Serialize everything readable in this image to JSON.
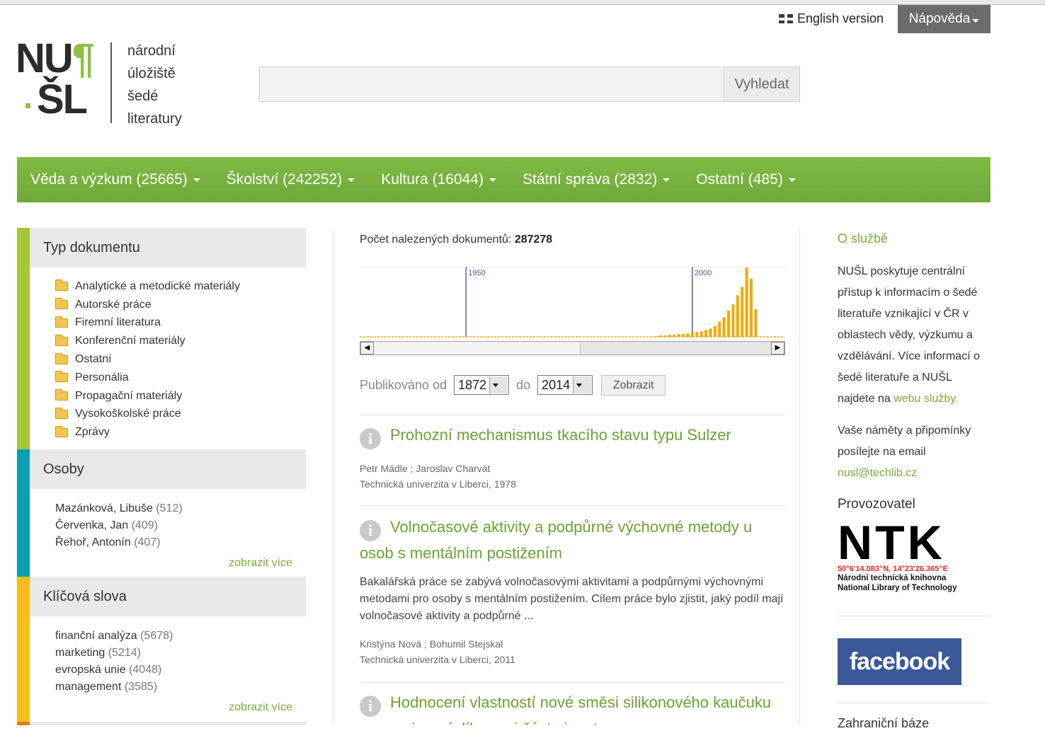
{
  "header": {
    "english_version": "English version",
    "help": "Nápověda",
    "logo_letters_top": "NU",
    "logo_para": "¶",
    "logo_letters_bottom": "ŠL",
    "logo_lines": [
      "národní",
      "úložiště",
      "šedé",
      "literatury"
    ],
    "search_placeholder": "",
    "search_value": "",
    "search_button": "Vyhledat"
  },
  "nav": [
    {
      "label": "Věda a výzkum (25665)"
    },
    {
      "label": "Školství (242252)"
    },
    {
      "label": "Kultura (16044)"
    },
    {
      "label": "Státní správa (2832)"
    },
    {
      "label": "Ostatní (485)"
    }
  ],
  "sidebar": {
    "doc_type": {
      "title": "Typ dokumentu",
      "color": "#a4c639",
      "items": [
        "Analytické a metodické materiály",
        "Autorské práce",
        "Firemní literatura",
        "Konferenční materiály",
        "Ostatní",
        "Personália",
        "Propagační materiály",
        "Vysokoškolské práce",
        "Zprávy"
      ]
    },
    "persons": {
      "title": "Osoby",
      "color": "#0aa0b4",
      "items": [
        {
          "name": "Mazánková, Libuše",
          "count": "(512)"
        },
        {
          "name": "Červenka, Jan",
          "count": "(409)"
        },
        {
          "name": "Řehoř, Antonín",
          "count": "(407)"
        }
      ],
      "more": "zobrazit více"
    },
    "keywords": {
      "title": "Klíčová slova",
      "color": "#f9bd1a",
      "items": [
        {
          "name": "finanční analýza",
          "count": "(5678)"
        },
        {
          "name": "marketing",
          "count": "(5214)"
        },
        {
          "name": "evropská unie",
          "count": "(4048)"
        },
        {
          "name": "management",
          "count": "(3585)"
        }
      ],
      "more": "zobrazit více"
    }
  },
  "main": {
    "count_label": "Počet nalezených dokumentů:",
    "count_value": "287278",
    "published_from_label": "Publikováno od",
    "from_value": "1872",
    "to_label": "do",
    "to_value": "2014",
    "show_button": "Zobrazit",
    "results": [
      {
        "title": "Prohozní mechanismus tkacího stavu typu Sulzer",
        "abstract": "",
        "authors": "Petr Mádle ; Jaroslav Charvát",
        "source": "Technická univerzita v Liberci, 1978"
      },
      {
        "title": "Volnočasové aktivity a podpůrné výchovné metody u osob s mentálním postižením",
        "abstract": "Bakalářská práce se zabývá volnočasovými aktivitami a podpůrnými výchovnými metodami pro osoby s mentálním postižením. Cílem práce bylo zjistit, jaký podíl mají volnočasové aktivity a podpůrné ...",
        "authors": "Kristýna Nová ; Bohumil Stejskal",
        "source": "Technická univerzita v Liberci, 2011"
      },
      {
        "title": "Hodnocení vlastností nové směsi silikonového kaučuku pro spojovací díly mezi čéstmi motoru",
        "abstract": "",
        "authors": "",
        "source": ""
      }
    ]
  },
  "chart_data": {
    "type": "bar",
    "title": "",
    "xlabel": "",
    "ylabel": "",
    "marker_labels": [
      "1950",
      "2000"
    ],
    "bar_color": "#f7a600",
    "x": [
      1992,
      1993,
      1994,
      1995,
      1996,
      1997,
      1998,
      1999,
      2000,
      2001,
      2002,
      2003,
      2004,
      2005,
      2006,
      2007,
      2008,
      2009,
      2010,
      2011,
      2012,
      2013,
      2014
    ],
    "values": [
      1,
      2,
      2,
      3,
      3,
      4,
      4,
      5,
      6,
      7,
      8,
      10,
      12,
      16,
      22,
      28,
      38,
      47,
      60,
      72,
      100,
      84,
      40
    ],
    "ylim": [
      0,
      100
    ]
  },
  "right": {
    "about_title": "O službě",
    "about_text": "NUŠL poskytuje centrální přístup k informacím o šedé literatuře vznikající v ČR v oblastech vědy, výzkumu a vzdělávání. Více informací o šedé literatuře a NUŠL najdete na",
    "about_link": "webu služby.",
    "contact_text": "Vaše náměty a připomínky posílejte na email",
    "email": "nusl@techlib.cz",
    "operator_title": "Provozovatel",
    "ntk_logo": "NTK",
    "ntk_coords": "50°6'14.083\"N, 14°23'26.365\"E",
    "ntk_line1": "Národní technická knihovna",
    "ntk_line2": "National Library of Technology",
    "facebook": "facebook",
    "foreign_title": "Zahraniční báze"
  }
}
